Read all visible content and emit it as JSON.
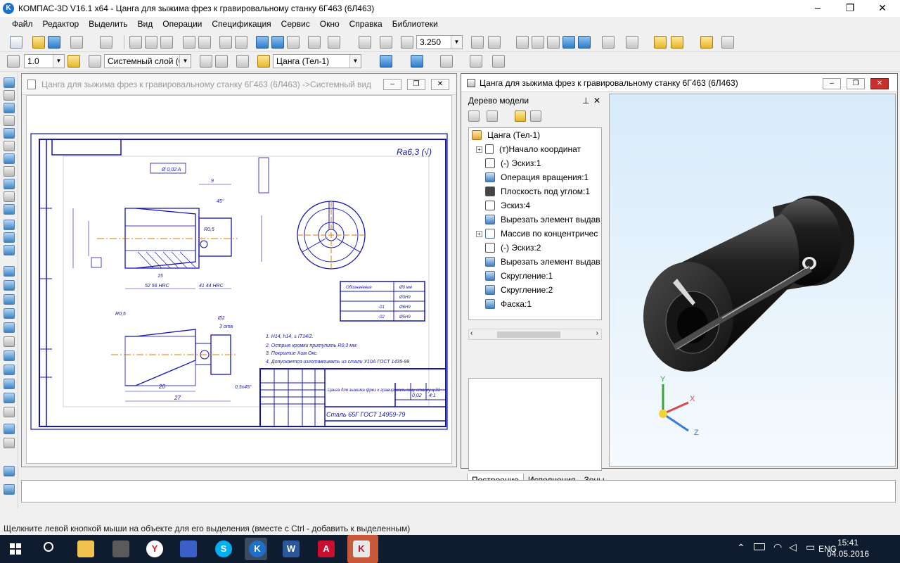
{
  "window": {
    "title": "КОМПАС-3D V16.1 x64 - Цанга для зыжима фрез к гравировальному станку 6Г463 (6Л463)"
  },
  "menu": [
    "Файл",
    "Редактор",
    "Выделить",
    "Вид",
    "Операции",
    "Спецификация",
    "Сервис",
    "Окно",
    "Справка",
    "Библиотеки"
  ],
  "toolbar": {
    "zoom_value": "3.250",
    "line_scale": "1.0",
    "layer_value": "Системный слой (0)",
    "body_value": "Цанга (Тел-1)"
  },
  "drawing_window": {
    "title": "Цанга для зыжима фрез к гравировальному станку 6Г463 (6Л463) ->Системный вид"
  },
  "model_window": {
    "title": "Цанга для зыжима фрез к гравировальному станку 6Г463 (6Л463)"
  },
  "tree": {
    "header": "Дерево модели",
    "items": [
      {
        "label": "Цанга (Тел-1)",
        "icon": "part-icon"
      },
      {
        "label": "(т)Начало координат",
        "icon": "origin-icon"
      },
      {
        "label": "(-) Эскиз:1",
        "icon": "sketch-icon"
      },
      {
        "label": "Операция вращения:1",
        "icon": "revolve-icon"
      },
      {
        "label": "Плоскость под углом:1",
        "icon": "plane-icon"
      },
      {
        "label": "Эскиз:4",
        "icon": "sketch-icon"
      },
      {
        "label": "Вырезать элемент выдав.",
        "icon": "cut-extrude-icon"
      },
      {
        "label": "Массив по концентричес",
        "icon": "pattern-icon"
      },
      {
        "label": "(-) Эскиз:2",
        "icon": "sketch-icon"
      },
      {
        "label": "Вырезать элемент выдав.",
        "icon": "cut-extrude-icon"
      },
      {
        "label": "Скругление:1",
        "icon": "fillet-icon"
      },
      {
        "label": "Скругление:2",
        "icon": "fillet-icon"
      },
      {
        "label": "Фаска:1",
        "icon": "chamfer-icon"
      }
    ],
    "tabs": [
      "Построение",
      "Исполнения",
      "Зоны"
    ]
  },
  "drawing": {
    "roughness": "Ra6,3 (√)",
    "notes": [
      "1. H14, h14, ± IT14/2.",
      "2. Острые кромки притупить R0,3 мм.",
      "3. Покрытие Хим.Окс.",
      "4. Допускается изготавливать из стали У10А ГОСТ 1435-99"
    ],
    "title_block": {
      "name": "Цанга для зыжима фрез к гравировальному станку ц.31",
      "material": "Сталь 65Г ГОСТ 14959-79",
      "mass": "0,02",
      "scale": "4:1"
    },
    "table": {
      "headers": [
        "Обозначение",
        "Ø0 мм"
      ],
      "rows": [
        [
          "",
          "Ø3H9"
        ],
        [
          "-01",
          "Ø6H9"
        ],
        [
          "-02",
          "Ø5H9"
        ]
      ]
    },
    "dims": [
      "Ø 0,02 A",
      "9",
      "45°",
      "R0,5",
      "15",
      "52 56 HRC",
      "41 44 HRC",
      "Ø2",
      "R0,5",
      "20",
      "27",
      "0,5x45°",
      "3 отв"
    ]
  },
  "statusbar": "Щелкните левой кнопкой мыши на объекте для его выделения (вместе с Ctrl - добавить к выделенным)",
  "taskbar": {
    "language": "ENG",
    "time": "15:41",
    "date": "04.05.2016"
  },
  "axes": {
    "x": "X",
    "y": "Y",
    "z": "Z"
  }
}
